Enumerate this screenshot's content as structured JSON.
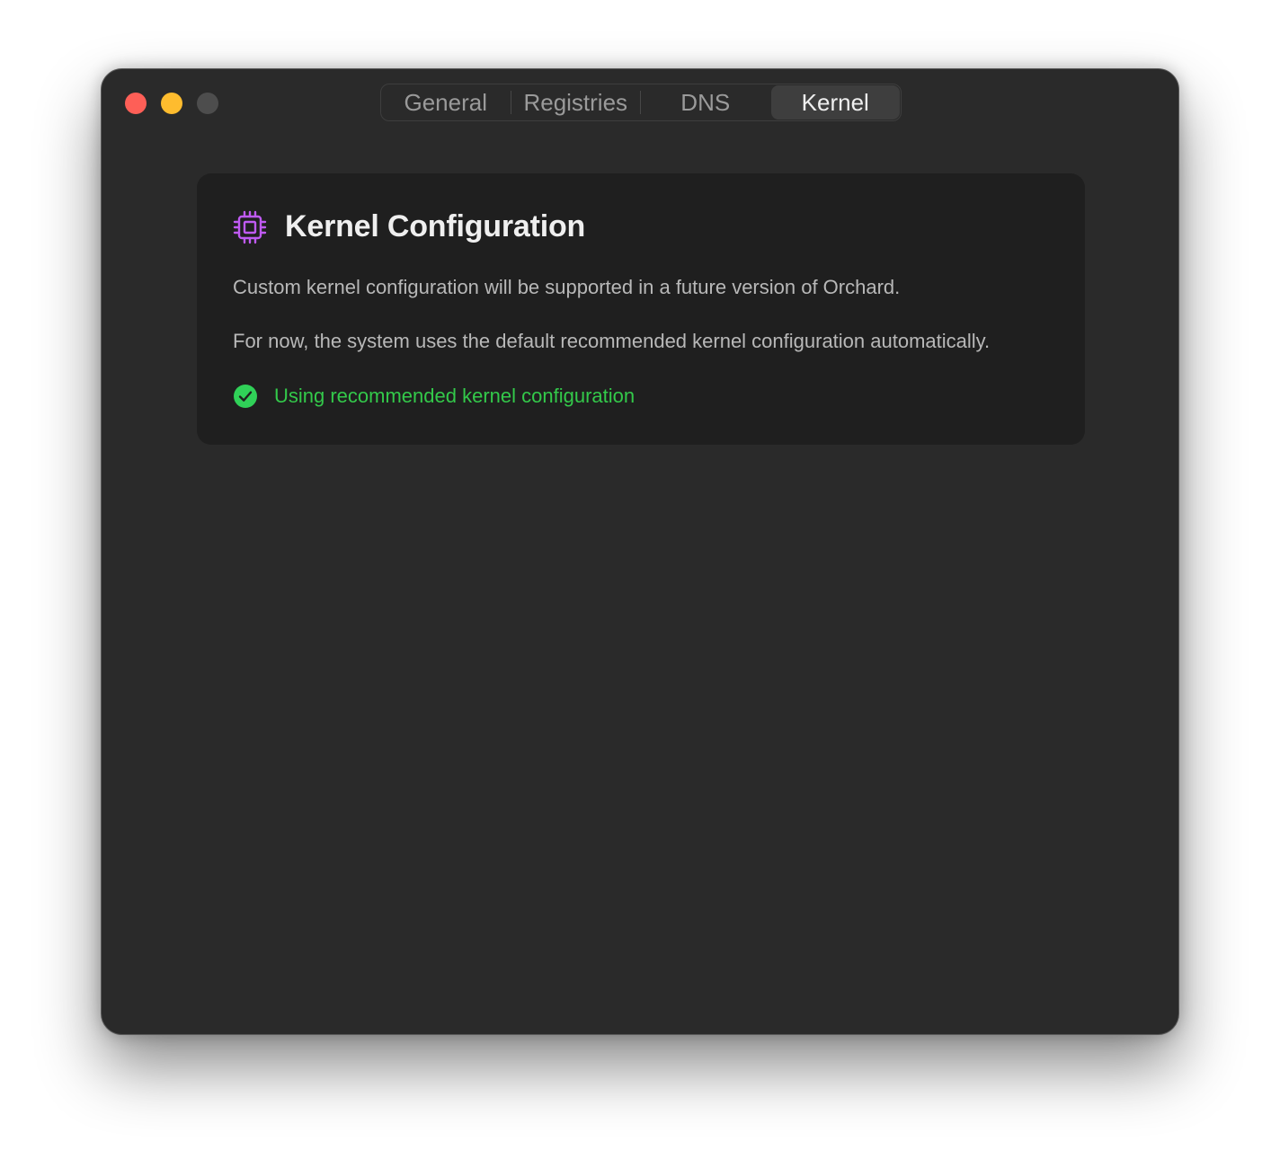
{
  "window": {
    "traffic_lights": [
      {
        "name": "close",
        "color": "#fe5f57"
      },
      {
        "name": "minimize",
        "color": "#febc2e"
      },
      {
        "name": "zoom",
        "color": "#4d4d4d"
      }
    ]
  },
  "tabs": {
    "items": [
      {
        "label": "General",
        "active": false
      },
      {
        "label": "Registries",
        "active": false
      },
      {
        "label": "DNS",
        "active": false
      },
      {
        "label": "Kernel",
        "active": true
      }
    ]
  },
  "card": {
    "icon": "cpu-chip-icon",
    "icon_color": "#bf5af2",
    "title": "Kernel Configuration",
    "line1": "Custom kernel configuration will be supported in a future version of Orchard.",
    "line2": "For now, the system uses the default recommended kernel configuration automatically.",
    "status": {
      "icon": "checkmark-circle-icon",
      "color": "#30d158",
      "text": "Using recommended kernel configuration"
    }
  }
}
